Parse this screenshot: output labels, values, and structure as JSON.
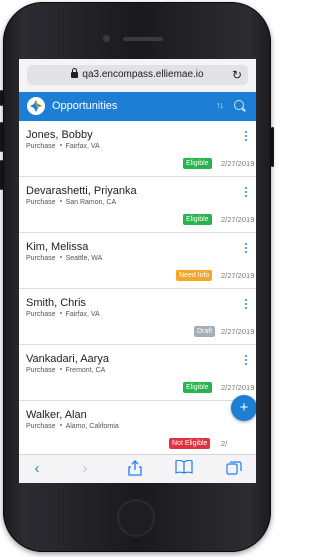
{
  "browser": {
    "url": "qa3.encompass.elliemae.io"
  },
  "app": {
    "title": "Opportunities",
    "sort_glyph": "↑↓"
  },
  "opportunities": [
    {
      "name": "Jones, Bobby",
      "type": "Purchase",
      "location": "Fairfax, VA",
      "status": "Eligible",
      "status_color": "#2bb24c",
      "date": "2/27/2019"
    },
    {
      "name": "Devarashetti, Priyanka",
      "type": "Purchase",
      "location": "San Ramon, CA",
      "status": "Eligible",
      "status_color": "#2bb24c",
      "date": "2/27/2019"
    },
    {
      "name": "Kim, Melissa",
      "type": "Purchase",
      "location": "Seattle, WA",
      "status": "Need Info",
      "status_color": "#f5a623",
      "date": "2/27/2019"
    },
    {
      "name": "Smith, Chris",
      "type": "Purchase",
      "location": "Fairfax, VA",
      "status": "Draft",
      "status_color": "#a7adb6",
      "date": "2/27/2019"
    },
    {
      "name": "Vankadari, Aarya",
      "type": "Purchase",
      "location": "Fremont, CA",
      "status": "Eligible",
      "status_color": "#2bb24c",
      "date": "2/27/2019"
    },
    {
      "name": "Walker, Alan",
      "type": "Purchase",
      "location": "Alamo, California",
      "status": "Not Eligible",
      "status_color": "#e0323f",
      "date": "2/"
    }
  ],
  "fab": {
    "label": "+"
  },
  "colors": {
    "brand": "#1c7ed4",
    "toolbar_icon": "#1f7ef5"
  },
  "toolbar": {
    "icons": [
      "back-icon",
      "forward-icon",
      "share-icon",
      "bookmarks-icon",
      "tabs-icon"
    ]
  }
}
